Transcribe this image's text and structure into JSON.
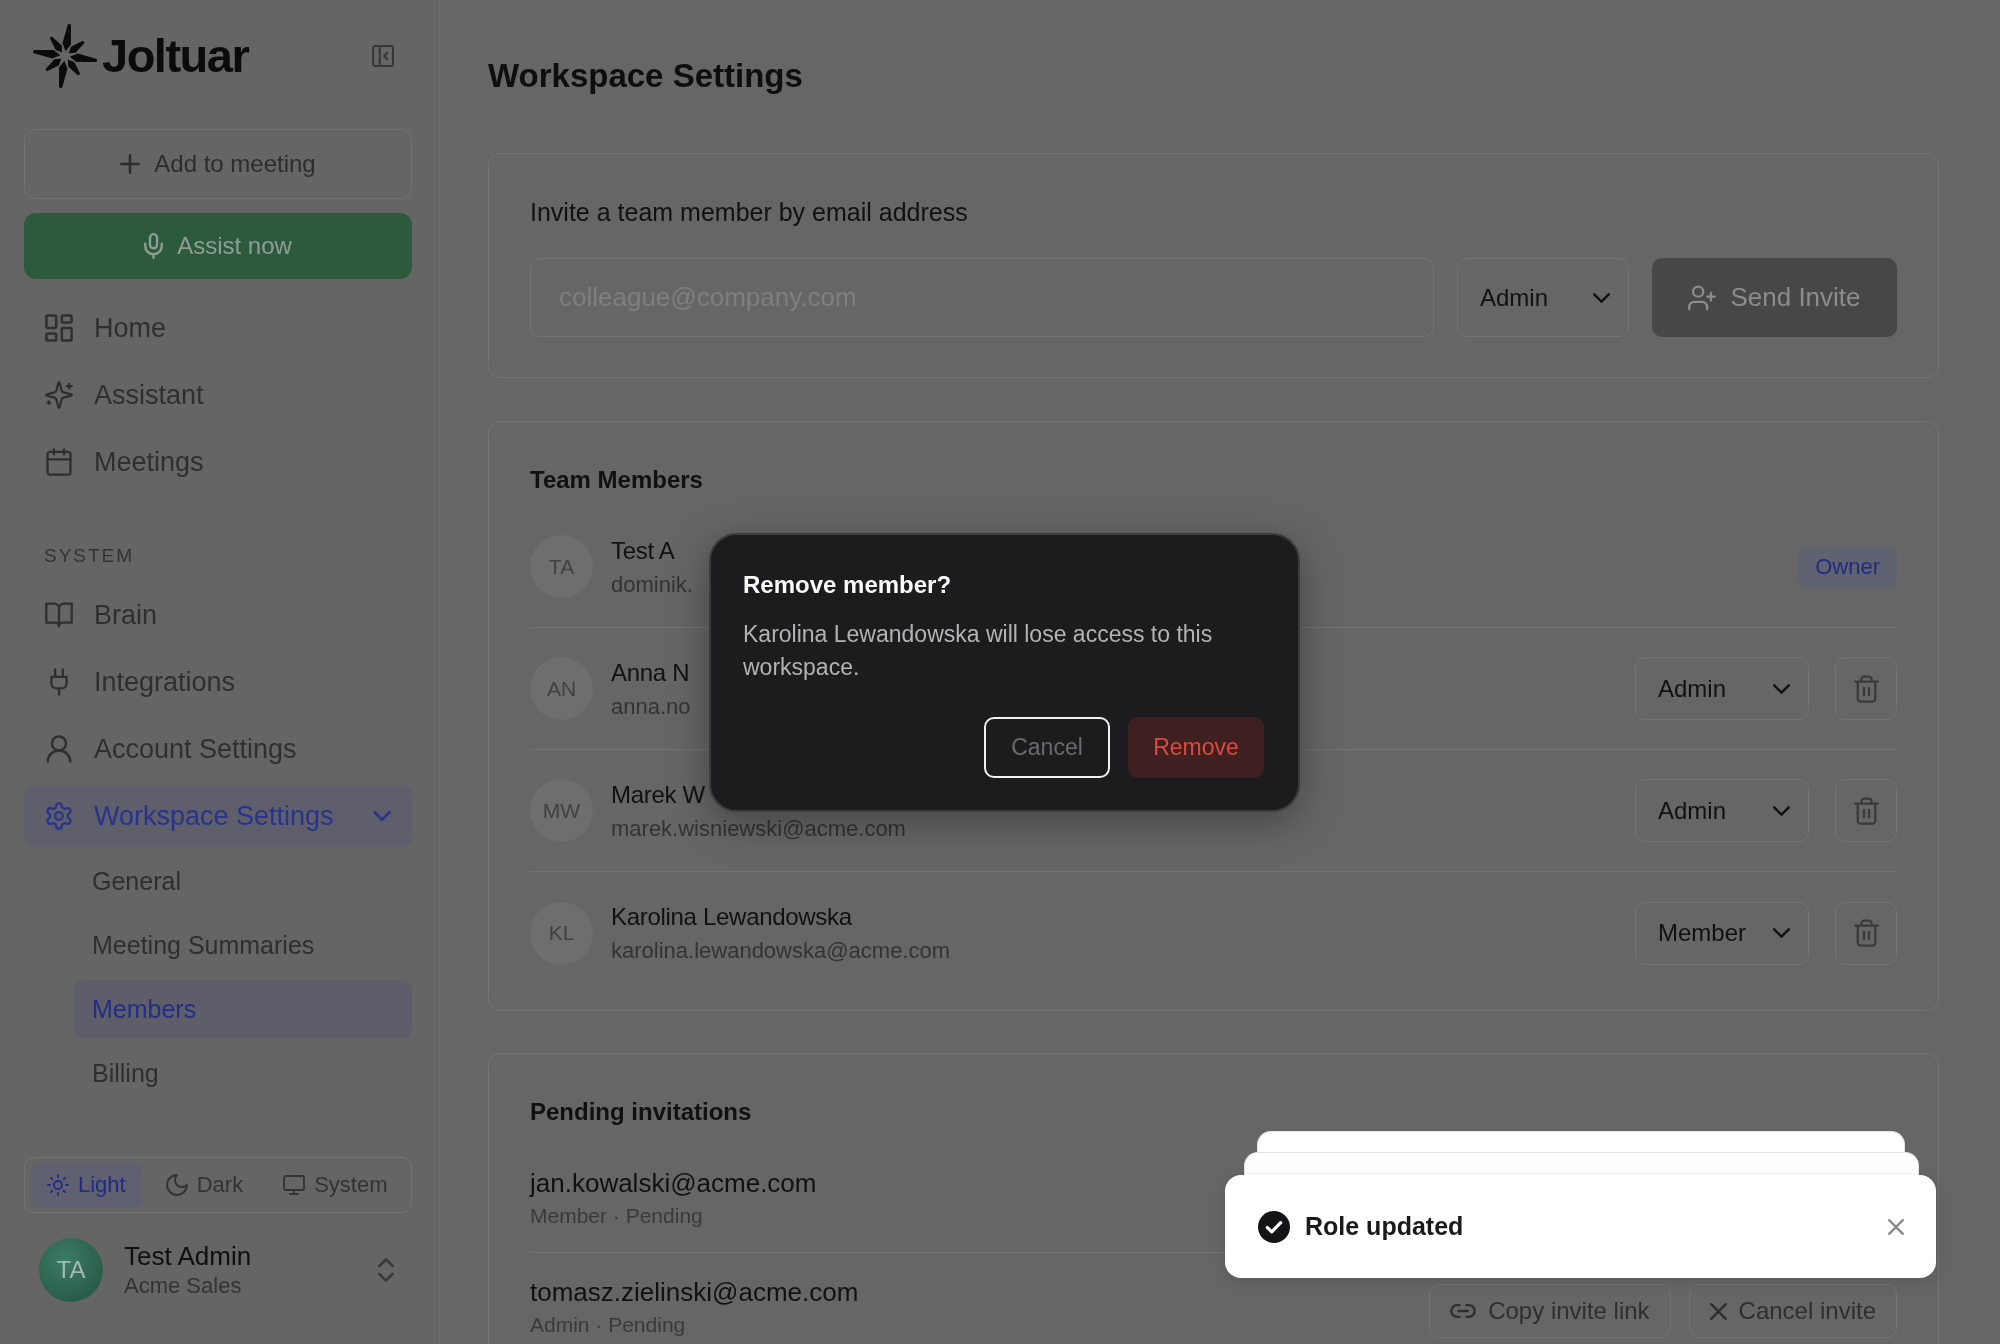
{
  "sidebar": {
    "logo": "Joltuar",
    "add_button": "Add to meeting",
    "assist_button": "Assist now",
    "nav": [
      {
        "label": "Home",
        "selected": false
      },
      {
        "label": "Assistant",
        "selected": false
      },
      {
        "label": "Meetings",
        "selected": false
      }
    ],
    "section_label": "SYSTEM",
    "system_nav": [
      {
        "label": "Brain",
        "selected": false
      },
      {
        "label": "Integrations",
        "selected": false
      },
      {
        "label": "Account Settings",
        "selected": false
      },
      {
        "label": "Workspace Settings",
        "selected": true,
        "expanded": true,
        "children": [
          {
            "label": "General",
            "selected": false
          },
          {
            "label": "Meeting Summaries",
            "selected": false
          },
          {
            "label": "Members",
            "selected": true
          },
          {
            "label": "Billing",
            "selected": false
          }
        ]
      }
    ],
    "theme": [
      {
        "label": "Light",
        "selected": true
      },
      {
        "label": "Dark",
        "selected": false
      },
      {
        "label": "System",
        "selected": false
      }
    ],
    "user": {
      "initials": "TA",
      "name": "Test Admin",
      "org": "Acme Sales"
    }
  },
  "page_title": "Workspace Settings",
  "invite": {
    "heading": "Invite a team member by email address",
    "email": {
      "placeholder": "colleague@company.com"
    },
    "role": "Admin",
    "button": "Send Invite",
    "disabled": true
  },
  "team": {
    "heading": "Team Members",
    "members": [
      {
        "initials": "TA",
        "name": "Test A",
        "email": "dominik.",
        "kind": "owner",
        "role": "Owner"
      },
      {
        "initials": "AN",
        "name": "Anna N",
        "email": "anna.no",
        "kind": "editable",
        "role": "Admin"
      },
      {
        "initials": "MW",
        "name": "Marek W",
        "email": "marek.wisniewski@acme.com",
        "kind": "editable",
        "role": "Admin"
      },
      {
        "initials": "KL",
        "name": "Karolina Lewandowska",
        "email": "karolina.lewandowska@acme.com",
        "kind": "editable",
        "role": "Member"
      }
    ]
  },
  "pending": {
    "heading": "Pending invitations",
    "invitations": [
      {
        "email": "jan.kowalski@acme.com",
        "meta": "Member · Pending"
      },
      {
        "email": "tomasz.zielinski@acme.com",
        "meta": "Admin · Pending",
        "actions": [
          {
            "kind": "link",
            "label": "Copy invite link"
          },
          {
            "kind": "cancel",
            "label": "Cancel invite"
          }
        ]
      }
    ]
  },
  "dialog": {
    "title": "Remove member?",
    "message": "Karolina Lewandowska will lose access to this workspace.",
    "cancel": "Cancel",
    "confirm": "Remove"
  },
  "toast": {
    "message": "Role updated"
  }
}
